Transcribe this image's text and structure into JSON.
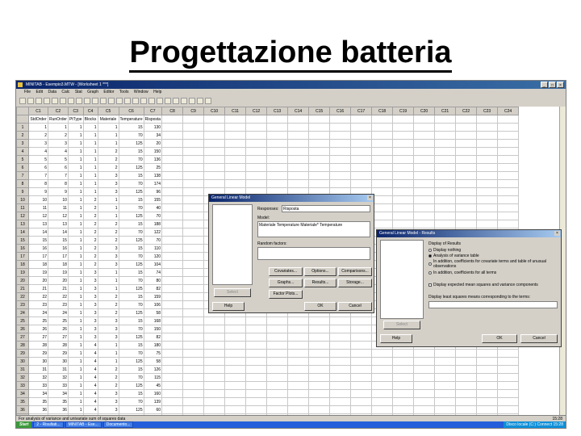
{
  "slide": {
    "title": "Progettazione batteria"
  },
  "app": {
    "title": "MINITAB - Esempio3.MTW - [Worksheet 1 ***]",
    "win_controls": [
      "_",
      "□",
      "×"
    ]
  },
  "menu": [
    "File",
    "Edit",
    "Data",
    "Calc",
    "Stat",
    "Graph",
    "Editor",
    "Tools",
    "Window",
    "Help"
  ],
  "toolbar": [
    "s",
    "o",
    "p",
    "x",
    "c",
    "v",
    "u",
    "r",
    "?",
    "i",
    "d",
    "g",
    "h",
    "k",
    "m",
    "n",
    "t",
    "q",
    "f",
    "a",
    "e",
    "w",
    "z",
    "y"
  ],
  "sheet": {
    "col_ids": [
      "C1",
      "C2",
      "C3",
      "C4",
      "C5",
      "C6",
      "C7",
      "C8",
      "C9",
      "C10",
      "C11",
      "C12",
      "C13",
      "C14",
      "C15",
      "C16",
      "C17",
      "C18",
      "C19",
      "C20",
      "C21",
      "C22",
      "C23",
      "C24"
    ],
    "col_names": [
      "StdOrder",
      "RunOrder",
      "PtType",
      "Blocks",
      "Materiale",
      "Temperature",
      "Risposta",
      "",
      "",
      "",
      "",
      "",
      "",
      "",
      "",
      "",
      "",
      "",
      "",
      "",
      "",
      "",
      "",
      ""
    ],
    "rows": [
      [
        "1",
        "1",
        "1",
        "1",
        "1",
        "15",
        "130"
      ],
      [
        "2",
        "2",
        "1",
        "1",
        "1",
        "70",
        "34"
      ],
      [
        "3",
        "3",
        "1",
        "1",
        "1",
        "125",
        "20"
      ],
      [
        "4",
        "4",
        "1",
        "1",
        "2",
        "15",
        "150"
      ],
      [
        "5",
        "5",
        "1",
        "1",
        "2",
        "70",
        "136"
      ],
      [
        "6",
        "6",
        "1",
        "1",
        "2",
        "125",
        "25"
      ],
      [
        "7",
        "7",
        "1",
        "1",
        "3",
        "15",
        "138"
      ],
      [
        "8",
        "8",
        "1",
        "1",
        "3",
        "70",
        "174"
      ],
      [
        "9",
        "9",
        "1",
        "1",
        "3",
        "125",
        "96"
      ],
      [
        "10",
        "10",
        "1",
        "2",
        "1",
        "15",
        "155"
      ],
      [
        "11",
        "11",
        "1",
        "2",
        "1",
        "70",
        "40"
      ],
      [
        "12",
        "12",
        "1",
        "2",
        "1",
        "125",
        "70"
      ],
      [
        "13",
        "13",
        "1",
        "2",
        "2",
        "15",
        "188"
      ],
      [
        "14",
        "14",
        "1",
        "2",
        "2",
        "70",
        "122"
      ],
      [
        "15",
        "15",
        "1",
        "2",
        "2",
        "125",
        "70"
      ],
      [
        "16",
        "16",
        "1",
        "2",
        "3",
        "15",
        "110"
      ],
      [
        "17",
        "17",
        "1",
        "2",
        "3",
        "70",
        "120"
      ],
      [
        "18",
        "18",
        "1",
        "2",
        "3",
        "125",
        "104"
      ],
      [
        "19",
        "19",
        "1",
        "3",
        "1",
        "15",
        "74"
      ],
      [
        "20",
        "20",
        "1",
        "3",
        "1",
        "70",
        "80"
      ],
      [
        "21",
        "21",
        "1",
        "3",
        "1",
        "125",
        "82"
      ],
      [
        "22",
        "22",
        "1",
        "3",
        "2",
        "15",
        "159"
      ],
      [
        "23",
        "23",
        "1",
        "3",
        "2",
        "70",
        "106"
      ],
      [
        "24",
        "24",
        "1",
        "3",
        "2",
        "125",
        "58"
      ],
      [
        "25",
        "25",
        "1",
        "3",
        "3",
        "15",
        "168"
      ],
      [
        "26",
        "26",
        "1",
        "3",
        "3",
        "70",
        "150"
      ],
      [
        "27",
        "27",
        "1",
        "3",
        "3",
        "125",
        "82"
      ],
      [
        "28",
        "28",
        "1",
        "4",
        "1",
        "15",
        "180"
      ],
      [
        "29",
        "29",
        "1",
        "4",
        "1",
        "70",
        "75"
      ],
      [
        "30",
        "30",
        "1",
        "4",
        "1",
        "125",
        "58"
      ],
      [
        "31",
        "31",
        "1",
        "4",
        "2",
        "15",
        "126"
      ],
      [
        "32",
        "32",
        "1",
        "4",
        "2",
        "70",
        "115"
      ],
      [
        "33",
        "33",
        "1",
        "4",
        "2",
        "125",
        "45"
      ],
      [
        "34",
        "34",
        "1",
        "4",
        "3",
        "15",
        "160"
      ],
      [
        "35",
        "35",
        "1",
        "4",
        "3",
        "70",
        "139"
      ],
      [
        "36",
        "36",
        "1",
        "4",
        "3",
        "125",
        "60"
      ]
    ],
    "row_labels": [
      "1",
      "2",
      "3",
      "4",
      "5",
      "6",
      "7",
      "8",
      "9",
      "10",
      "11",
      "12",
      "13",
      "14",
      "15",
      "16",
      "17",
      "18",
      "19",
      "20",
      "21",
      "22",
      "23",
      "24",
      "25",
      "26",
      "27",
      "28",
      "29",
      "30",
      "31",
      "32",
      "33",
      "34",
      "35",
      "36",
      "37",
      "38",
      "39",
      "40",
      "41"
    ]
  },
  "status": {
    "text": "For analysis of variance and univariate sum of squares data",
    "time": "15:28"
  },
  "taskbar": {
    "start": "Start",
    "tasks": [
      "2 - Risultati...",
      "MINITAB - Ese...",
      "Documento..."
    ],
    "tray": "Disco locale (C:)   Connect   15:28"
  },
  "glm": {
    "title": "General Linear Model",
    "responses_label": "Responses:",
    "responses_value": "Risposta",
    "model_label": "Model:",
    "model_value": "Materiale Temperature Materiale* Temperature",
    "random_label": "Random factors:",
    "buttons": {
      "covariates": "Covariates...",
      "options": "Options...",
      "comparisons": "Comparisons...",
      "graphs": "Graphs...",
      "results": "Results...",
      "storage": "Storage...",
      "factor_plots": "Factor Plots...",
      "select": "Select",
      "help": "Help",
      "ok": "OK",
      "cancel": "Cancel"
    }
  },
  "results": {
    "title": "General Linear Model - Results",
    "display_label": "Display of Results",
    "options": [
      "Display nothing",
      "Analysis of variance table",
      "In addition, coefficients for covariate terms and table of unusual observations",
      "In addition, coefficients for all terms"
    ],
    "selected_index": 1,
    "check_label": "Display expected mean squares and variance components",
    "lsm_label": "Display least squares means corresponding to the terms:",
    "buttons": {
      "select": "Select",
      "help": "Help",
      "ok": "OK",
      "cancel": "Cancel"
    }
  }
}
